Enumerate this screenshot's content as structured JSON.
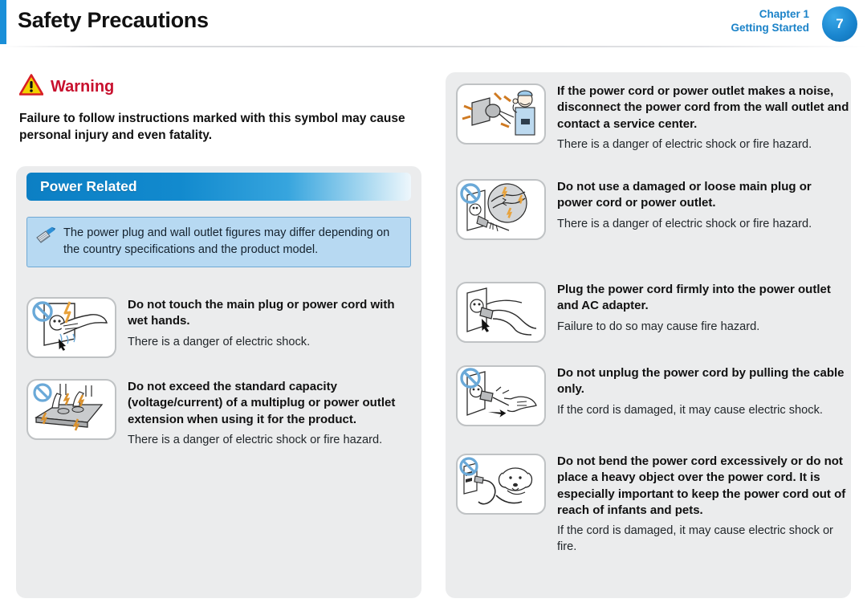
{
  "header": {
    "title": "Safety Precautions",
    "chapter_label": "Chapter 1",
    "chapter_name": "Getting Started",
    "page_number": "7",
    "accent_color": "#1a8fd8"
  },
  "warning": {
    "icon": "warning-triangle-icon",
    "label": "Warning",
    "label_color": "#c8102e",
    "body": "Failure to follow instructions marked with this symbol may cause personal injury and even fatality."
  },
  "section": {
    "banner_title": "Power Related",
    "note_icon": "note-pencil-icon",
    "note_text": "The power plug and wall outlet figures may differ depending on the country specifications and the product model."
  },
  "left_items": [
    {
      "icon": "wet-hands-plug-prohibited-icon",
      "title": "Do not touch the main plug or power cord with wet hands.",
      "desc": "There is a danger of electric shock."
    },
    {
      "icon": "multiplug-overload-prohibited-icon",
      "title": "Do not exceed the standard capacity (voltage/current) of a multiplug or power outlet extension when using it for the product.",
      "desc": "There is a danger of electric shock or fire hazard."
    }
  ],
  "right_items": [
    {
      "icon": "service-technician-noisy-outlet-icon",
      "title": "If the power cord or power outlet makes a noise, disconnect the power cord from the wall outlet and contact a service center.",
      "desc": "There is a danger of electric shock or fire hazard."
    },
    {
      "icon": "damaged-plug-prohibited-icon",
      "title": "Do not use a damaged or loose main plug or power cord or power outlet.",
      "desc": "There is a danger of electric shock or fire hazard."
    },
    {
      "icon": "plug-firmly-inserted-icon",
      "title": "Plug the power cord firmly into the power outlet and AC adapter.",
      "desc": "Failure to do so may cause fire hazard."
    },
    {
      "icon": "pull-cable-prohibited-icon",
      "title": "Do not unplug the power cord by pulling the cable only.",
      "desc": "If the cord is damaged, it may cause electric shock."
    },
    {
      "icon": "pet-chewing-cord-prohibited-icon",
      "title": "Do not bend the power cord excessively or do not place a heavy object over the power cord. It is especially important to keep the power cord out of reach of infants and pets.",
      "desc": "If the cord is damaged, it may cause electric shock or fire."
    }
  ]
}
